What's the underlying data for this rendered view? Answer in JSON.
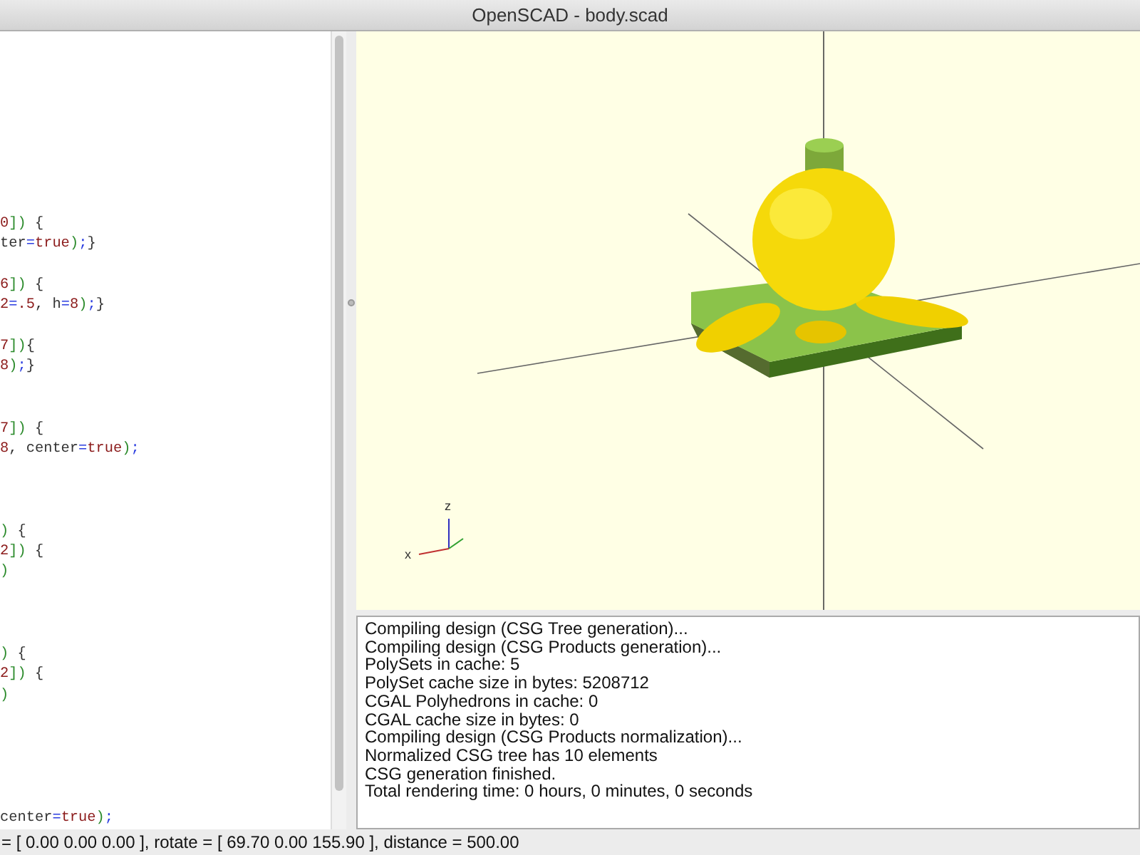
{
  "window": {
    "title": "OpenSCAD - body.scad"
  },
  "editor": {
    "lines": [
      {
        "kind": "blank"
      },
      {
        "kind": "blank"
      },
      {
        "kind": "blank"
      },
      {
        "kind": "blank"
      },
      {
        "kind": "blank"
      },
      {
        "kind": "blank"
      },
      {
        "kind": "blank"
      },
      {
        "kind": "code",
        "tokens": [
          {
            "kind": "num",
            "text": "0"
          },
          {
            "kind": "bracket",
            "text": "])"
          },
          {
            "kind": "plain",
            "text": " {"
          }
        ]
      },
      {
        "kind": "code",
        "tokens": [
          {
            "kind": "plain",
            "text": "ter"
          },
          {
            "kind": "op",
            "text": "="
          },
          {
            "kind": "num",
            "text": "true"
          },
          {
            "kind": "bracket",
            "text": ")"
          },
          {
            "kind": "op",
            "text": ";"
          },
          {
            "kind": "plain",
            "text": "}"
          }
        ]
      },
      {
        "kind": "blank"
      },
      {
        "kind": "code",
        "tokens": [
          {
            "kind": "num",
            "text": "6"
          },
          {
            "kind": "bracket",
            "text": "])"
          },
          {
            "kind": "plain",
            "text": " {"
          }
        ]
      },
      {
        "kind": "code",
        "tokens": [
          {
            "kind": "num",
            "text": "2"
          },
          {
            "kind": "op",
            "text": "="
          },
          {
            "kind": "num",
            "text": ".5"
          },
          {
            "kind": "plain",
            "text": ", h"
          },
          {
            "kind": "op",
            "text": "="
          },
          {
            "kind": "num",
            "text": "8"
          },
          {
            "kind": "bracket",
            "text": ")"
          },
          {
            "kind": "op",
            "text": ";"
          },
          {
            "kind": "plain",
            "text": "}"
          }
        ]
      },
      {
        "kind": "blank"
      },
      {
        "kind": "code",
        "tokens": [
          {
            "kind": "num",
            "text": "7"
          },
          {
            "kind": "bracket",
            "text": "])"
          },
          {
            "kind": "plain",
            "text": "{"
          }
        ]
      },
      {
        "kind": "code",
        "tokens": [
          {
            "kind": "num",
            "text": "8"
          },
          {
            "kind": "bracket",
            "text": ")"
          },
          {
            "kind": "op",
            "text": ";"
          },
          {
            "kind": "plain",
            "text": "}"
          }
        ]
      },
      {
        "kind": "blank"
      },
      {
        "kind": "blank"
      },
      {
        "kind": "code",
        "tokens": [
          {
            "kind": "num",
            "text": "7"
          },
          {
            "kind": "bracket",
            "text": "])"
          },
          {
            "kind": "plain",
            "text": " {"
          }
        ]
      },
      {
        "kind": "code",
        "tokens": [
          {
            "kind": "num",
            "text": "8"
          },
          {
            "kind": "plain",
            "text": ", center"
          },
          {
            "kind": "op",
            "text": "="
          },
          {
            "kind": "num",
            "text": "true"
          },
          {
            "kind": "bracket",
            "text": ")"
          },
          {
            "kind": "op",
            "text": ";"
          }
        ]
      },
      {
        "kind": "blank"
      },
      {
        "kind": "blank"
      },
      {
        "kind": "blank"
      },
      {
        "kind": "code",
        "tokens": [
          {
            "kind": "bracket",
            "text": ")"
          },
          {
            "kind": "plain",
            "text": " {"
          }
        ]
      },
      {
        "kind": "code",
        "tokens": [
          {
            "kind": "num",
            "text": "2"
          },
          {
            "kind": "bracket",
            "text": "])"
          },
          {
            "kind": "plain",
            "text": " {"
          }
        ]
      },
      {
        "kind": "code",
        "tokens": [
          {
            "kind": "bracket",
            "text": ")"
          }
        ]
      },
      {
        "kind": "blank"
      },
      {
        "kind": "blank"
      },
      {
        "kind": "blank"
      },
      {
        "kind": "code",
        "tokens": [
          {
            "kind": "bracket",
            "text": ")"
          },
          {
            "kind": "plain",
            "text": " {"
          }
        ]
      },
      {
        "kind": "code",
        "tokens": [
          {
            "kind": "num",
            "text": "2"
          },
          {
            "kind": "bracket",
            "text": "])"
          },
          {
            "kind": "plain",
            "text": " {"
          }
        ]
      },
      {
        "kind": "code",
        "tokens": [
          {
            "kind": "bracket",
            "text": ")"
          }
        ]
      },
      {
        "kind": "blank"
      },
      {
        "kind": "blank"
      },
      {
        "kind": "blank"
      },
      {
        "kind": "blank"
      },
      {
        "kind": "blank"
      },
      {
        "kind": "code",
        "tokens": [
          {
            "kind": "plain",
            "text": "center"
          },
          {
            "kind": "op",
            "text": "="
          },
          {
            "kind": "num",
            "text": "true"
          },
          {
            "kind": "bracket",
            "text": ")"
          },
          {
            "kind": "op",
            "text": ";"
          }
        ]
      }
    ]
  },
  "viewport": {
    "axis_labels": [
      "z",
      "x"
    ]
  },
  "console": {
    "lines": [
      "Compiling design (CSG Tree generation)...",
      "Compiling design (CSG Products generation)...",
      "PolySets in cache: 5",
      "PolySet cache size in bytes: 5208712",
      "CGAL Polyhedrons in cache: 0",
      "CGAL cache size in bytes: 0",
      "Compiling design (CSG Products normalization)...",
      "Normalized CSG tree has 10 elements",
      "CSG generation finished.",
      "Total rendering time: 0 hours, 0 minutes, 0 seconds"
    ]
  },
  "status_bar": {
    "text": "= [ 0.00 0.00 0.00 ], rotate = [ 69.70 0.00 155.90 ], distance = 500.00"
  }
}
